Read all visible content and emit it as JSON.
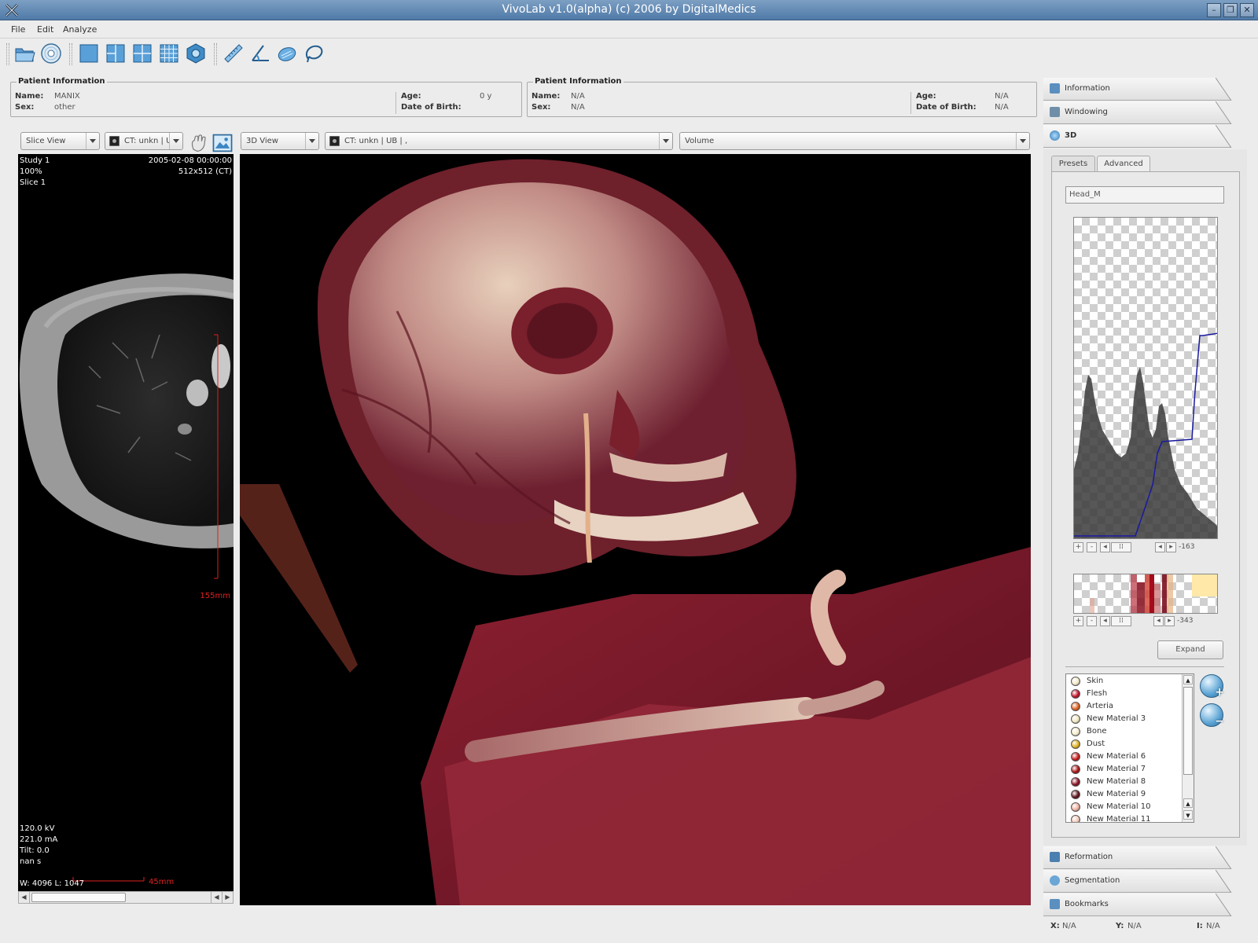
{
  "window": {
    "title": "VivoLab v1.0(alpha)      (c) 2006 by DigitalMedics",
    "minimize_glyph": "–",
    "maximize_glyph": "❐",
    "close_glyph": "✕"
  },
  "menu": [
    "File",
    "Edit",
    "Analyze"
  ],
  "toolbar": {
    "buttons": [
      "open-folder-icon",
      "cd-import-icon",
      "layout-single-icon",
      "layout-split-icon",
      "layout-quad-icon",
      "layout-grid-icon",
      "view-3d-icon",
      "ruler-icon",
      "angle-icon",
      "roi-ellipse-icon",
      "lasso-icon"
    ]
  },
  "patient_left": {
    "legend": "Patient Information",
    "name_label": "Name:",
    "name": "MANIX",
    "sex_label": "Sex:",
    "sex": "other",
    "age_label": "Age:",
    "age": "0 y",
    "dob_label": "Date of Birth:",
    "dob": ""
  },
  "patient_right": {
    "legend": "Patient Information",
    "name_label": "Name:",
    "name": "N/A",
    "sex_label": "Sex:",
    "sex": "N/A",
    "age_label": "Age:",
    "age": "N/A",
    "dob_label": "Date of Birth:",
    "dob": "N/A"
  },
  "slice_panel": {
    "view_type": "Slice View",
    "series": "CT: unkn | U",
    "overlay": {
      "study": "Study 1",
      "datetime": "2005-02-08    00:00:00",
      "zoom": "100%",
      "matrix": "512x512 (CT)",
      "slice": "Slice 1",
      "kv": "120.0 kV",
      "ma": "221.0 mA",
      "tilt": "Tilt: 0.0",
      "time": "nan s",
      "window": "W: 4096   L: 1047",
      "vert_scale": "155mm",
      "horiz_scale": "45mm"
    }
  },
  "view3d_panel": {
    "view_type": "3D View",
    "series": "CT: unkn | UB | ,",
    "mode": "Volume"
  },
  "right_panel": {
    "tabs_top": [
      "Information",
      "Windowing",
      "3D"
    ],
    "tabs_bottom": [
      "Reformation",
      "Segmentation",
      "Bookmarks"
    ],
    "sub_tabs": [
      "Presets",
      "Advanced"
    ],
    "active_sub_tab": "Advanced",
    "preset_name": "Head_M",
    "tf_value_1": "-163",
    "tf_value_2": "-343",
    "expand_label": "Expand",
    "materials": [
      {
        "name": "Skin",
        "color": "#f4e8c8"
      },
      {
        "name": "Flesh",
        "color": "#c0102a"
      },
      {
        "name": "Arteria",
        "color": "#e06020"
      },
      {
        "name": "New Material 3",
        "color": "#efe6c0"
      },
      {
        "name": "Bone",
        "color": "#f5eccc"
      },
      {
        "name": "Dust",
        "color": "#e0b020"
      },
      {
        "name": "New Material 6",
        "color": "#c81818"
      },
      {
        "name": "New Material 7",
        "color": "#a81010"
      },
      {
        "name": "New Material 8",
        "color": "#8a1020"
      },
      {
        "name": "New Material 9",
        "color": "#5a1018"
      },
      {
        "name": "New Material 10",
        "color": "#f0b0a0"
      },
      {
        "name": "New Material 11",
        "color": "#f2c8b8"
      }
    ]
  },
  "status": {
    "x_label": "X:",
    "x": "N/A",
    "y_label": "Y:",
    "y": "N/A",
    "i_label": "I:",
    "i": "N/A"
  }
}
